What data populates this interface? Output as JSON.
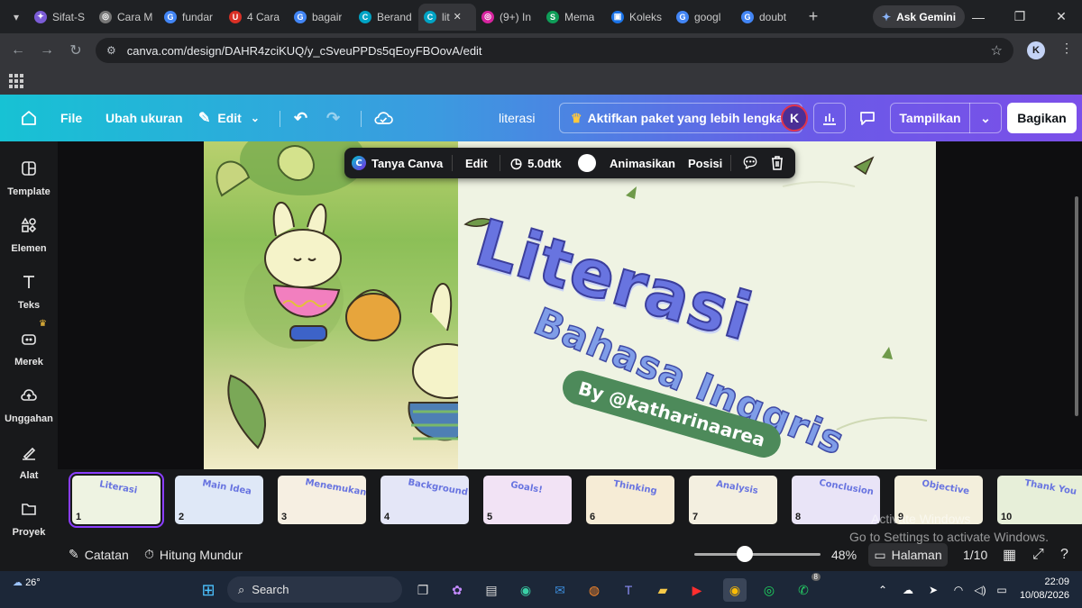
{
  "browser": {
    "tabs": [
      {
        "title": "Sifat-S",
        "color": "#7b5cd6",
        "glyph": "✦"
      },
      {
        "title": "Cara M",
        "color": "#777777",
        "glyph": "◎"
      },
      {
        "title": "fundar",
        "color": "#4285f4",
        "glyph": "G"
      },
      {
        "title": "4 Cara",
        "color": "#d93025",
        "glyph": "U"
      },
      {
        "title": "bagair",
        "color": "#4285f4",
        "glyph": "G"
      },
      {
        "title": "Berand",
        "color": "#00a3c4",
        "glyph": "C"
      },
      {
        "title": "lit",
        "color": "#00a3c4",
        "glyph": "C",
        "active": true
      },
      {
        "title": "(9+) In",
        "color": "#d6249f",
        "glyph": "◎"
      },
      {
        "title": "Mema",
        "color": "#0f9d58",
        "glyph": "S"
      },
      {
        "title": "Koleks",
        "color": "#1a73e8",
        "glyph": "▣"
      },
      {
        "title": "googl",
        "color": "#4285f4",
        "glyph": "G"
      },
      {
        "title": "doubt",
        "color": "#4285f4",
        "glyph": "G"
      }
    ],
    "gemini_label": "Ask Gemini",
    "url": "canva.com/design/DAHR4zciKUQ/y_cSveuPPDs5qEoyFBOovA/edit",
    "profile_initial": "K"
  },
  "canva_toolbar": {
    "file": "File",
    "resize": "Ubah ukuran",
    "edit": "Edit",
    "doc_title": "literasi",
    "upgrade": "Aktifkan paket yang lebih lengkap",
    "avatar": "K",
    "present": "Tampilkan",
    "share": "Bagikan"
  },
  "rail": [
    {
      "label": "Template",
      "icon": "template-icon"
    },
    {
      "label": "Elemen",
      "icon": "elements-icon"
    },
    {
      "label": "Teks",
      "icon": "text-icon"
    },
    {
      "label": "Merek",
      "icon": "brand-icon"
    },
    {
      "label": "Unggahan",
      "icon": "upload-icon"
    },
    {
      "label": "Alat",
      "icon": "tools-icon"
    },
    {
      "label": "Proyek",
      "icon": "folder-icon"
    }
  ],
  "float_toolbar": {
    "ask": "Tanya Canva",
    "edit": "Edit",
    "duration": "5.0dtk",
    "animate": "Animasikan",
    "position": "Posisi"
  },
  "slide": {
    "title": "Literasi",
    "subtitle": "Bahasa Inggris",
    "author": "By @katharinaarea"
  },
  "thumbnails": [
    {
      "num": "1",
      "label": "Literasi",
      "bg": "#eef3e2"
    },
    {
      "num": "2",
      "label": "Main Idea",
      "bg": "#dfe8f7"
    },
    {
      "num": "3",
      "label": "Menemukan",
      "bg": "#f6efe2"
    },
    {
      "num": "4",
      "label": "Background",
      "bg": "#e4e6f7"
    },
    {
      "num": "5",
      "label": "Goals!",
      "bg": "#f2e3f5"
    },
    {
      "num": "6",
      "label": "Thinking",
      "bg": "#f6ecd6"
    },
    {
      "num": "7",
      "label": "Analysis",
      "bg": "#f3efe0"
    },
    {
      "num": "8",
      "label": "Conclusion",
      "bg": "#e9e4f7"
    },
    {
      "num": "9",
      "label": "Objective",
      "bg": "#f3efdc"
    },
    {
      "num": "10",
      "label": "Thank You",
      "bg": "#e7efd9"
    }
  ],
  "bottom_bar": {
    "notes": "Catatan",
    "timer": "Hitung Mundur",
    "zoom": "48%",
    "zoom_level": 0.48,
    "pages_btn": "Halaman",
    "page_counter": "1/10"
  },
  "watermark": {
    "line1": "Activate Windows",
    "line2": "Go to Settings to activate Windows."
  },
  "taskbar": {
    "weather": "26°",
    "search": "Search",
    "time": "22:09",
    "date": "10/08/2026",
    "whatsapp_badge": "8"
  },
  "colors": {
    "accent": "#8b3dff",
    "canva_gradient_start": "#17c2d4",
    "canva_gradient_end": "#7b4fe9"
  }
}
